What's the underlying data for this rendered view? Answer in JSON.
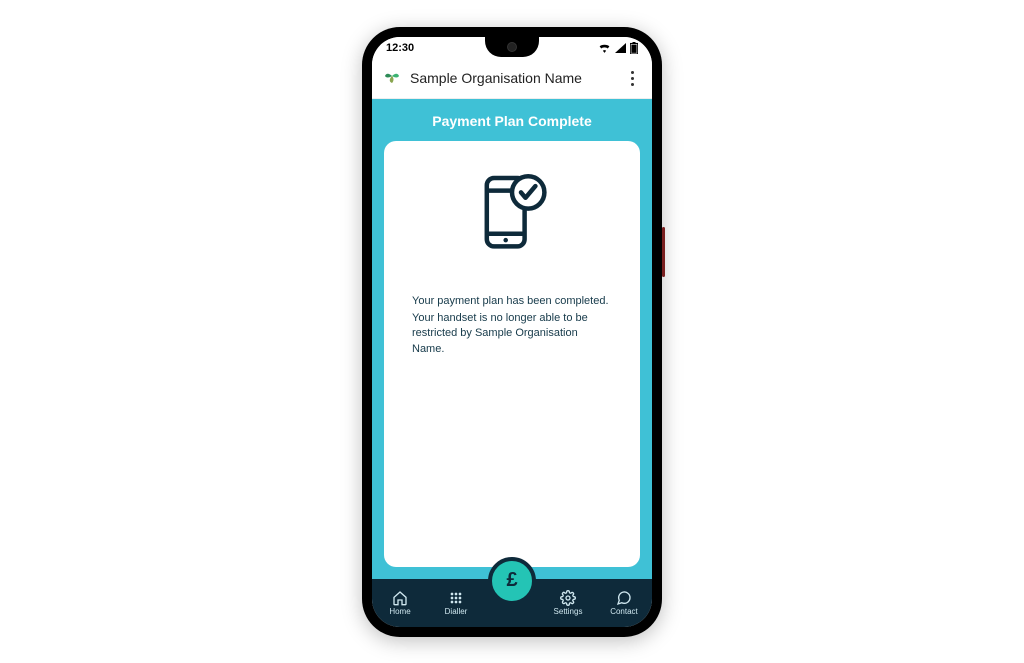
{
  "status": {
    "time": "12:30"
  },
  "appbar": {
    "title": "Sample Organisation Name"
  },
  "page": {
    "title": "Payment Plan Complete",
    "message1": "Your payment plan has been completed.",
    "message2": "Your handset is no longer able to be restricted by Sample Organisation Name."
  },
  "nav": {
    "home": "Home",
    "dialler": "Dialler",
    "fab_symbol": "£",
    "settings": "Settings",
    "contact": "Contact"
  }
}
